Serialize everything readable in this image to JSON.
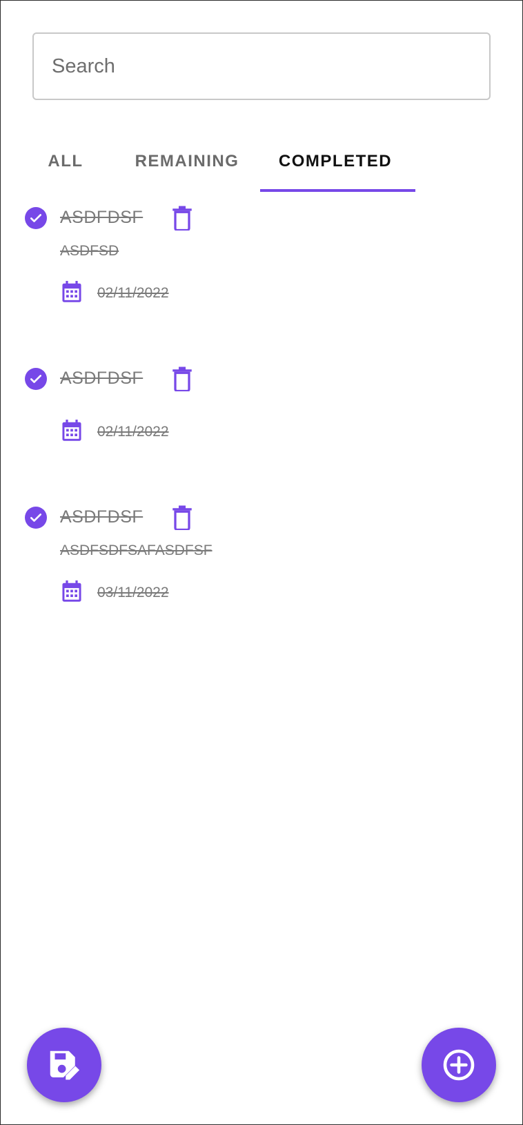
{
  "search": {
    "placeholder": "Search",
    "value": ""
  },
  "tabs": [
    {
      "label": "ALL",
      "active": false
    },
    {
      "label": "REMAINING",
      "active": false
    },
    {
      "label": "COMPLETED",
      "active": true
    }
  ],
  "todos": [
    {
      "title": "ASDFDSF",
      "description": "ASDFSD",
      "date": "02/11/2022",
      "completed": true
    },
    {
      "title": "ASDFDSF",
      "description": "",
      "date": "02/11/2022",
      "completed": true
    },
    {
      "title": "ASDFDSF",
      "description": "ASDFSDFSAFASDFSF",
      "date": "03/11/2022",
      "completed": true
    }
  ],
  "icons": {
    "check": "check-circle-icon",
    "delete": "trash-icon",
    "calendar": "calendar-icon",
    "save_fab": "save-edit-icon",
    "add_fab": "add-circle-icon"
  },
  "colors": {
    "accent": "#7748e8",
    "completed_text": "#7a7a7a"
  }
}
